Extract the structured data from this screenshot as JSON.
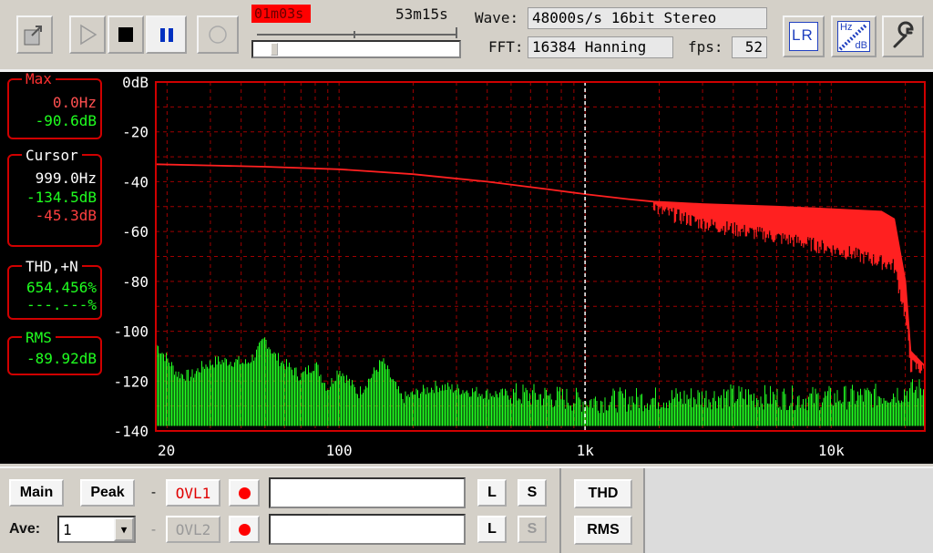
{
  "toolbar": {
    "time_elapsed": "01m03s",
    "time_total": "53m15s",
    "wave_label": "Wave:",
    "wave_value": "48000s/s 16bit Stereo",
    "fft_label": "FFT:",
    "fft_value": "16384 Hanning",
    "fps_label": "fps:",
    "fps_value": "52",
    "lr_text": "LR",
    "hzdb_top": "Hz",
    "hzdb_bottom": "dB",
    "progress_fraction": 0.08
  },
  "panels": {
    "max_title": "Max",
    "max_freq": "0.0Hz",
    "max_db": "-90.6dB",
    "cursor_title": "Cursor",
    "cursor_freq": "999.0Hz",
    "cursor_db_left": "-134.5dB",
    "cursor_db_right": "-45.3dB",
    "thd_title": "THD,+N",
    "thd_value": "654.456%",
    "thd_value2": "---.---%",
    "rms_title": "RMS",
    "rms_value": "-89.92dB"
  },
  "chart_data": {
    "type": "line",
    "xscale": "log",
    "xlim": [
      18,
      24000
    ],
    "ylim": [
      -140,
      0
    ],
    "y_ticks": [
      "0dB",
      "-20",
      "-40",
      "-60",
      "-80",
      "-100",
      "-120",
      "-140"
    ],
    "x_ticks": [
      "20",
      "100",
      "1k",
      "10k"
    ],
    "grid": true,
    "cursor_freq": 999,
    "series": [
      {
        "color": "#ff2020",
        "points": [
          [
            18,
            -33
          ],
          [
            30,
            -33.5
          ],
          [
            50,
            -34
          ],
          [
            100,
            -35
          ],
          [
            200,
            -37
          ],
          [
            400,
            -40
          ],
          [
            700,
            -43
          ],
          [
            1000,
            -45
          ],
          [
            1500,
            -47
          ],
          [
            1900,
            -48
          ],
          [
            3000,
            -49
          ],
          [
            6000,
            -50
          ],
          [
            10000,
            -51
          ],
          [
            16000,
            -52
          ],
          [
            18000,
            -55
          ],
          [
            20000,
            -80
          ],
          [
            21000,
            -108
          ],
          [
            24000,
            -114
          ]
        ],
        "lower_band": [
          [
            1900,
            -50
          ],
          [
            2000,
            -53
          ],
          [
            3000,
            -58
          ],
          [
            5000,
            -62
          ],
          [
            8000,
            -66
          ],
          [
            12000,
            -70
          ],
          [
            18000,
            -75
          ],
          [
            20000,
            -95
          ],
          [
            21000,
            -115
          ],
          [
            24000,
            -117
          ]
        ]
      },
      {
        "color": "#22ff22",
        "points": [
          [
            18,
            -105
          ],
          [
            20,
            -111
          ],
          [
            22,
            -117
          ],
          [
            25,
            -118
          ],
          [
            28,
            -114
          ],
          [
            32,
            -112
          ],
          [
            38,
            -112
          ],
          [
            42,
            -113
          ],
          [
            46,
            -109
          ],
          [
            50,
            -103
          ],
          [
            55,
            -110
          ],
          [
            60,
            -113
          ],
          [
            70,
            -118
          ],
          [
            80,
            -113
          ],
          [
            90,
            -123
          ],
          [
            100,
            -115
          ],
          [
            120,
            -125
          ],
          [
            150,
            -112
          ],
          [
            180,
            -127
          ],
          [
            250,
            -122
          ],
          [
            400,
            -125
          ],
          [
            700,
            -126
          ],
          [
            1000,
            -128
          ],
          [
            2000,
            -127
          ],
          [
            4000,
            -126
          ],
          [
            8000,
            -127
          ],
          [
            15000,
            -126
          ],
          [
            24000,
            -123
          ]
        ],
        "floor": -138
      }
    ]
  },
  "bottom": {
    "main_label": "Main",
    "peak_label": "Peak",
    "dash": "-",
    "ovl1_label": "OVL1",
    "ovl2_label": "OVL2",
    "ave_label": "Ave:",
    "ave_value": "1",
    "l_label": "L",
    "s_label": "S",
    "thd_label": "THD",
    "rms_label": "RMS"
  }
}
